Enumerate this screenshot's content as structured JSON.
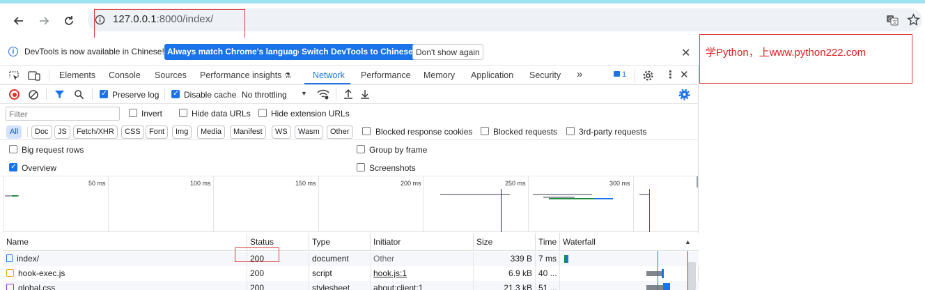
{
  "browser": {
    "url_host": "127.0.0.1",
    "url_rest": ":8000/index/",
    "back_icon": "arrow-left-icon",
    "forward_icon": "arrow-right-icon",
    "reload_icon": "reload-icon"
  },
  "infobar": {
    "message": "DevTools is now available in Chinese!",
    "btn_match": "Always match Chrome's language",
    "btn_switch": "Switch DevTools to Chinese",
    "btn_dont_show": "Don't show again"
  },
  "tabs": {
    "elements": "Elements",
    "console": "Console",
    "sources": "Sources",
    "perf_insights": "Performance insights",
    "network": "Network",
    "performance": "Performance",
    "memory": "Memory",
    "application": "Application",
    "security": "Security",
    "more": "»",
    "issues_count": "1"
  },
  "toolbar": {
    "preserve_log": "Preserve log",
    "disable_cache": "Disable cache",
    "throttling": "No throttling"
  },
  "filter": {
    "placeholder": "Filter",
    "invert": "Invert",
    "hide_data_urls": "Hide data URLs",
    "hide_extension_urls": "Hide extension URLs"
  },
  "chips": [
    "All",
    "Doc",
    "JS",
    "Fetch/XHR",
    "CSS",
    "Font",
    "Img",
    "Media",
    "Manifest",
    "WS",
    "Wasm",
    "Other"
  ],
  "type_filters": {
    "blocked_cookies": "Blocked response cookies",
    "blocked_requests": "Blocked requests",
    "third_party": "3rd-party requests"
  },
  "options": {
    "big_rows": "Big request rows",
    "group_by_frame": "Group by frame",
    "overview": "Overview",
    "screenshots": "Screenshots"
  },
  "timeline_labels": [
    "50 ms",
    "100 ms",
    "150 ms",
    "200 ms",
    "250 ms",
    "300 ms"
  ],
  "table": {
    "headers": {
      "name": "Name",
      "status": "Status",
      "type": "Type",
      "initiator": "Initiator",
      "size": "Size",
      "time": "Time",
      "waterfall": "Waterfall"
    },
    "rows": [
      {
        "name": "index/",
        "status": "200",
        "type": "document",
        "initiator": "Other",
        "size": "339 B",
        "time": "7 ms"
      },
      {
        "name": "hook-exec.js",
        "status": "200",
        "type": "script",
        "initiator": "hook.js:1",
        "size": "6.9 kB",
        "time": "40 ..."
      },
      {
        "name": "global.css",
        "status": "200",
        "type": "stylesheet",
        "initiator": "about:client:1",
        "size": "21.3 kB",
        "time": "51 ..."
      }
    ]
  },
  "annotation": {
    "text": "学Python，上www.python222.com"
  },
  "colors": {
    "accent": "#1a73e8",
    "annotation_red": "#d93b3b",
    "top_strip": "#9fe3f0"
  }
}
